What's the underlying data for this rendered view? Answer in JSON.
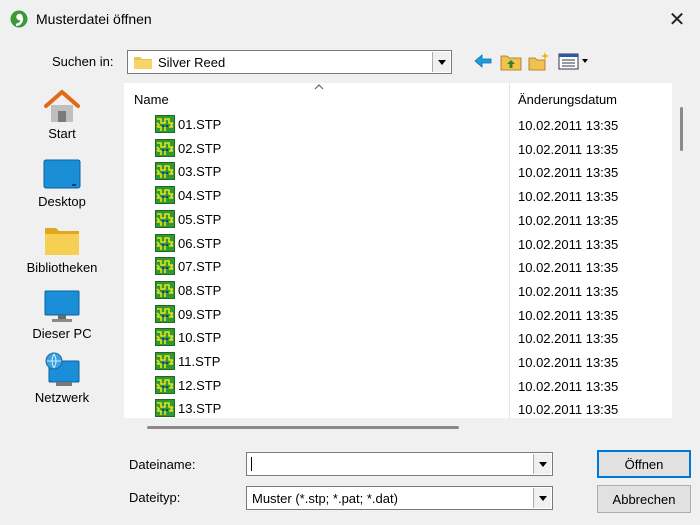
{
  "window": {
    "title": "Musterdatei öffnen",
    "close": "✕"
  },
  "lookin": {
    "label": "Suchen in:",
    "value": "Silver Reed"
  },
  "places": [
    {
      "label": "Start",
      "icon": "home-icon"
    },
    {
      "label": "Desktop",
      "icon": "desktop-icon"
    },
    {
      "label": "Bibliotheken",
      "icon": "libraries-icon"
    },
    {
      "label": "Dieser PC",
      "icon": "this-pc-icon"
    },
    {
      "label": "Netzwerk",
      "icon": "network-icon"
    }
  ],
  "columns": {
    "name": "Name",
    "date": "Änderungsdatum"
  },
  "files": [
    {
      "name": "01.STP",
      "date": "10.02.2011 13:35"
    },
    {
      "name": "02.STP",
      "date": "10.02.2011 13:35"
    },
    {
      "name": "03.STP",
      "date": "10.02.2011 13:35"
    },
    {
      "name": "04.STP",
      "date": "10.02.2011 13:35"
    },
    {
      "name": "05.STP",
      "date": "10.02.2011 13:35"
    },
    {
      "name": "06.STP",
      "date": "10.02.2011 13:35"
    },
    {
      "name": "07.STP",
      "date": "10.02.2011 13:35"
    },
    {
      "name": "08.STP",
      "date": "10.02.2011 13:35"
    },
    {
      "name": "09.STP",
      "date": "10.02.2011 13:35"
    },
    {
      "name": "10.STP",
      "date": "10.02.2011 13:35"
    },
    {
      "name": "11.STP",
      "date": "10.02.2011 13:35"
    },
    {
      "name": "12.STP",
      "date": "10.02.2011 13:35"
    },
    {
      "name": "13.STP",
      "date": "10.02.2011 13:35"
    }
  ],
  "filename": {
    "label": "Dateiname:",
    "value": ""
  },
  "filetype": {
    "label": "Dateityp:",
    "value": "Muster (*.stp; *.pat; *.dat)"
  },
  "buttons": {
    "open": "Öffnen",
    "cancel": "Abbrechen"
  },
  "colors": {
    "accent": "#0078d7",
    "folder": "#f2c14e",
    "background": "#f0f0f0"
  }
}
